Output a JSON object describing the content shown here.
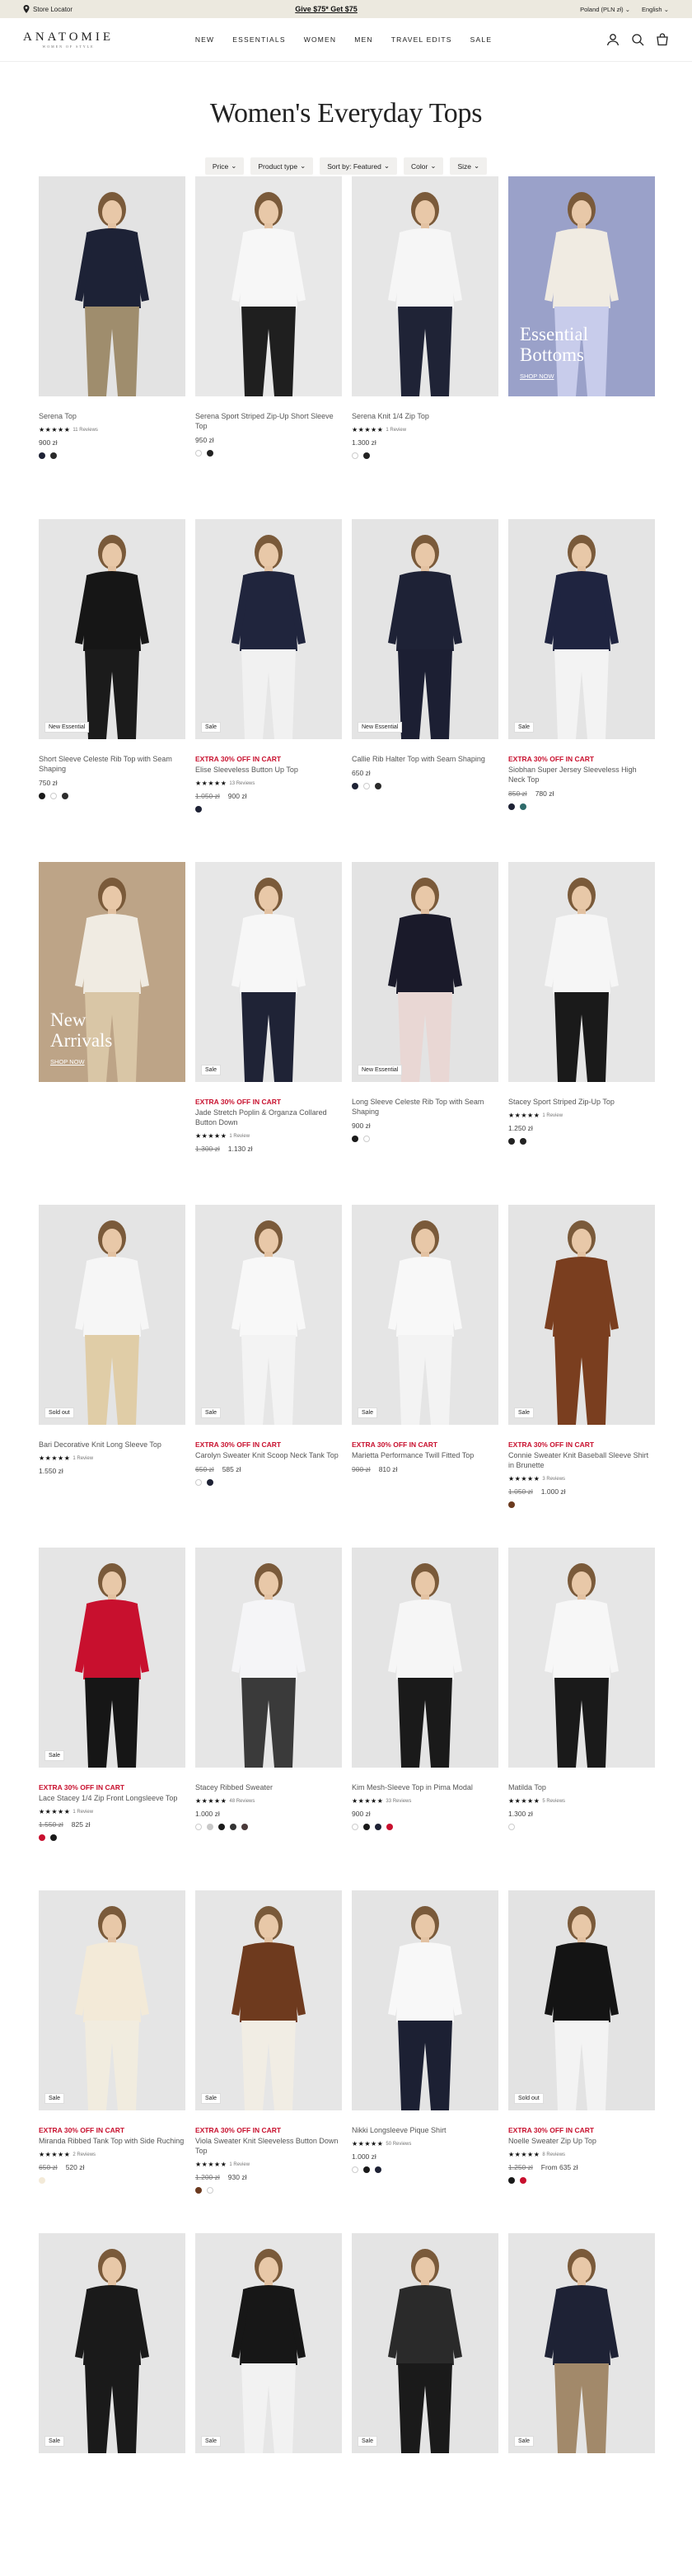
{
  "announcement": {
    "store_locator": "Store Locator",
    "offer": "Give $75* Get $75",
    "region": "Poland (PLN zł)",
    "language": "English"
  },
  "header": {
    "logo": "ANATOMIE",
    "logo_sub": "WOMEN OF STYLE",
    "nav": [
      "NEW",
      "ESSENTIALS",
      "WOMEN",
      "MEN",
      "TRAVEL EDITS",
      "SALE"
    ]
  },
  "page": {
    "title": "Women's Everyday Tops",
    "filters": [
      "Price",
      "Product type",
      "Sort by: Featured",
      "Color",
      "Size"
    ]
  },
  "colors": {
    "promo_red": "#c8102e",
    "announce_bg": "#ece9df"
  },
  "products": [
    {
      "name": "Serena Top",
      "stars": "★★★★★",
      "reviews": "11 Reviews",
      "price": "900 zł",
      "swatches": [
        "#1e2235",
        "#2a2a2a"
      ],
      "top": "#1d2236",
      "bottom": "#9f8d6d",
      "bg": "#e3e3e3"
    },
    {
      "name": "Serena Sport Striped Zip-Up Short Sleeve Top",
      "price": "950 zł",
      "swatches": [
        "#ffffff",
        "#222222"
      ],
      "top": "#f7f7f7",
      "bottom": "#1f1f1f",
      "bg": "#e8e8e8"
    },
    {
      "name": "Serena Knit 1/4 Zip Top",
      "stars": "★★★★★",
      "reviews": "1 Review",
      "price": "1.300 zł",
      "swatches": [
        "#ffffff",
        "#222222"
      ],
      "top": "#f6f6f6",
      "bottom": "#1f2336",
      "bg": "#e6e6e6"
    },
    {
      "promo": true,
      "title": "Essential\nBottoms",
      "link": "SHOP NOW",
      "bg": "#9aa1c9"
    },
    {
      "badge": "New Essential",
      "name": "Short Sleeve Celeste Rib Top with Seam Shaping",
      "price": "750 zł",
      "swatches": [
        "#1a1a1a",
        "#ffffff",
        "#2d2d2d"
      ],
      "top": "#161616",
      "bottom": "#1b1b1b",
      "bg": "#e5e5e5"
    },
    {
      "badge": "Sale",
      "promo_text": "EXTRA 30% OFF IN CART",
      "name": "Elise Sleeveless Button Up Top",
      "stars": "★★★★★",
      "reviews": "13 Reviews",
      "old_price": "1.050 zł",
      "price": "900 zł",
      "swatches": [
        "#1e2235"
      ],
      "top": "#20253d",
      "bottom": "#f1f1f1",
      "bg": "#e6e6e6"
    },
    {
      "badge": "New Essential",
      "name": "Callie Rib Halter Top with Seam Shaping",
      "price": "650 zł",
      "swatches": [
        "#1e2235",
        "#ffffff",
        "#2a2a2a"
      ],
      "top": "#1e2236",
      "bottom": "#1c1f33",
      "bg": "#e4e4e4"
    },
    {
      "badge": "Sale",
      "promo_text": "EXTRA 30% OFF IN CART",
      "name": "Siobhan Super Jersey Sleeveless High Neck Top",
      "old_price": "850 zł",
      "price": "780 zł",
      "swatches": [
        "#1e2235",
        "#2e6b6b"
      ],
      "top": "#1f2440",
      "bottom": "#f3f3f3",
      "bg": "#e4e4e4"
    },
    {
      "promo": true,
      "title": "New\nArrivals",
      "link": "SHOP NOW",
      "bg": "#bda487"
    },
    {
      "badge": "Sale",
      "promo_text": "EXTRA 30% OFF IN CART",
      "name": "Jade Stretch Poplin & Organza Collared Button Down",
      "stars": "★★★★★",
      "reviews": "1 Review",
      "old_price": "1.300 zł",
      "price": "1.130 zł",
      "swatches": [],
      "top": "#f7f7f7",
      "bottom": "#1f2336",
      "bg": "#e7e7e7"
    },
    {
      "badge": "New Essential",
      "name": "Long Sleeve Celeste Rib Top with Seam Shaping",
      "price": "900 zł",
      "swatches": [
        "#1a1a1a",
        "#ffffff"
      ],
      "top": "#1a1a2a",
      "bottom": "#e9d7d4",
      "bg": "#e3e3e3"
    },
    {
      "name": "Stacey Sport Striped Zip-Up Top",
      "stars": "★★★★★",
      "reviews": "1 Review",
      "price": "1.250 zł",
      "swatches": [
        "#222222",
        "#222222"
      ],
      "top": "#f6f6f6",
      "bottom": "#1a1a1a",
      "bg": "#e6e6e6"
    },
    {
      "badge": "Sold out",
      "name": "Bari Decorative Knit Long Sleeve Top",
      "stars": "★★★★★",
      "reviews": "1 Review",
      "price": "1.550 zł",
      "swatches": [],
      "top": "#f6f6f6",
      "bottom": "#e0cda7",
      "bg": "#e4e4e4"
    },
    {
      "badge": "Sale",
      "promo_text": "EXTRA 30% OFF IN CART",
      "name": "Carolyn Sweater Knit Scoop Neck Tank Top",
      "old_price": "650 zł",
      "price": "585 zł",
      "swatches": [
        "#ffffff",
        "#1e2235"
      ],
      "top": "#f8f8f8",
      "bottom": "#f3f3f3",
      "bg": "#e6e6e6"
    },
    {
      "badge": "Sale",
      "promo_text": "EXTRA 30% OFF IN CART",
      "name": "Marietta Performance Twill Fitted Top",
      "old_price": "900 zł",
      "price": "810 zł",
      "swatches": [],
      "top": "#f8f8f8",
      "bottom": "#f3f3f3",
      "bg": "#e5e5e5"
    },
    {
      "badge": "Sale",
      "promo_text": "EXTRA 30% OFF IN CART",
      "name": "Connie Sweater Knit Baseball Sleeve Shirt in Brunette",
      "stars": "★★★★★",
      "reviews": "3 Reviews",
      "old_price": "1.050 zł",
      "price": "1.000 zł",
      "swatches": [
        "#6b3a1f"
      ],
      "top": "#7a3e1f",
      "bottom": "#7a3e1f",
      "bg": "#e4e4e4"
    },
    {
      "badge": "Sale",
      "promo_text": "EXTRA 30% OFF IN CART",
      "name": "Lace Stacey 1/4 Zip Front Longsleeve Top",
      "stars": "★★★★★",
      "reviews": "1 Review",
      "old_price": "1.550 zł",
      "price": "825 zł",
      "swatches": [
        "#c8102e",
        "#1a1a1a"
      ],
      "top": "#c8102e",
      "bottom": "#161616",
      "bg": "#e5e5e5"
    },
    {
      "name": "Stacey Ribbed Sweater",
      "stars": "★★★★★",
      "reviews": "48 Reviews",
      "price": "1.000 zł",
      "swatches": [
        "#ffffff",
        "#c8c8c8",
        "#1a1a1a",
        "#333333",
        "#4a3a3a"
      ],
      "top": "#f5f5f7",
      "bottom": "#3a3a3a",
      "bg": "#e6e6e6"
    },
    {
      "name": "Kim Mesh-Sleeve Top in Pima Modal",
      "stars": "★★★★★",
      "reviews": "33 Reviews",
      "price": "900 zł",
      "swatches": [
        "#ffffff",
        "#1a1a1a",
        "#1e2235",
        "#c8102e"
      ],
      "top": "#f6f6f6",
      "bottom": "#1a1a1a",
      "bg": "#e4e4e4"
    },
    {
      "name": "Matilda Top",
      "stars": "★★★★★",
      "reviews": "5 Reviews",
      "price": "1.300 zł",
      "swatches": [
        "#ffffff"
      ],
      "top": "#f7f7f7",
      "bottom": "#1a1a1a",
      "bg": "#e6e6e6"
    },
    {
      "badge": "Sale",
      "promo_text": "EXTRA 30% OFF IN CART",
      "name": "Miranda Ribbed Tank Top with Side Ruching",
      "stars": "★★★★★",
      "reviews": "2 Reviews",
      "old_price": "650 zł",
      "price": "520 zł",
      "swatches": [
        "#f3ead8"
      ],
      "top": "#f3ead8",
      "bottom": "#f1ecdf",
      "bg": "#e5e5e5"
    },
    {
      "badge": "Sale",
      "promo_text": "EXTRA 30% OFF IN CART",
      "name": "Viola Sweater Knit Sleeveless Button Down Top",
      "stars": "★★★★★",
      "reviews": "1 Review",
      "old_price": "1.200 zł",
      "price": "930 zł",
      "swatches": [
        "#6b3a1f",
        "#ffffff"
      ],
      "top": "#6e3a1e",
      "bottom": "#f1ede4",
      "bg": "#e6e6e6"
    },
    {
      "name": "Nikki Longsleeve Pique Shirt",
      "stars": "★★★★★",
      "reviews": "50 Reviews",
      "price": "1.000 zł",
      "swatches": [
        "#ffffff",
        "#1a1a1a",
        "#1e2235"
      ],
      "top": "#f8f8f8",
      "bottom": "#1c2033",
      "bg": "#e4e4e4"
    },
    {
      "badge": "Sold out",
      "promo_text": "EXTRA 30% OFF IN CART",
      "name": "Noelle Sweater Zip Up Top",
      "stars": "★★★★★",
      "reviews": "8 Reviews",
      "old_price": "1.250 zł",
      "price": "From 635 zł",
      "swatches": [
        "#1a1a1a",
        "#c8102e"
      ],
      "top": "#141414",
      "bottom": "#f3f3f3",
      "bg": "#e3e3e3"
    },
    {
      "badge": "Sale",
      "top": "#1a1a1a",
      "bottom": "#1a1a1a",
      "bg": "#e5e5e5"
    },
    {
      "badge": "Sale",
      "top": "#171717",
      "bottom": "#f2f2f2",
      "bg": "#e6e6e6"
    },
    {
      "badge": "Sale",
      "top": "#2a2a2a",
      "bottom": "#1a1a1a",
      "bg": "#e4e4e4"
    },
    {
      "badge": "Sale",
      "top": "#1e2235",
      "bottom": "#a2896a",
      "bg": "#e5e5e5"
    }
  ]
}
